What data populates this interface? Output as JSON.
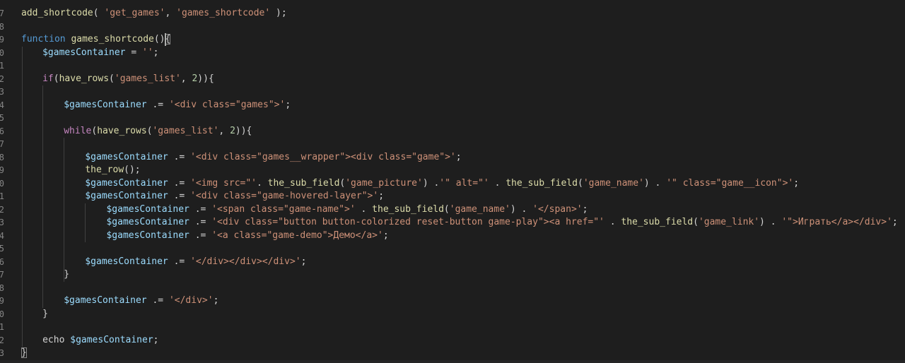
{
  "editor": {
    "line_numbers": [
      "7",
      "8",
      "9",
      "0",
      "1",
      "2",
      "3",
      "4",
      "5",
      "6",
      "7",
      "8",
      "9",
      "0",
      "1",
      "2",
      "3",
      "4",
      "5",
      "6",
      "7",
      "8",
      "9",
      "0",
      "1",
      "2",
      "3"
    ],
    "lines": [
      [
        [
          "fn",
          "add_shortcode"
        ],
        [
          "op",
          "( "
        ],
        [
          "str",
          "'get_games'"
        ],
        [
          "op",
          ", "
        ],
        [
          "str",
          "'games_shortcode'"
        ],
        [
          "op",
          " );"
        ]
      ],
      [],
      [
        [
          "kw",
          "function"
        ],
        [
          "op",
          " "
        ],
        [
          "fn",
          "games_shortcode"
        ],
        [
          "op",
          "()"
        ],
        [
          "op",
          "{"
        ]
      ],
      [
        [
          "var",
          "$gamesContainer"
        ],
        [
          "op",
          " = "
        ],
        [
          "str",
          "''"
        ],
        [
          "op",
          ";"
        ]
      ],
      [],
      [
        [
          "ctl",
          "if"
        ],
        [
          "op",
          "("
        ],
        [
          "fn",
          "have_rows"
        ],
        [
          "op",
          "("
        ],
        [
          "str",
          "'games_list'"
        ],
        [
          "op",
          ", "
        ],
        [
          "num",
          "2"
        ],
        [
          "op",
          "))"
        ],
        [
          "op",
          "{"
        ]
      ],
      [],
      [
        [
          "var",
          "$gamesContainer"
        ],
        [
          "op",
          " .= "
        ],
        [
          "str",
          "'<div class=\"games\">'"
        ],
        [
          "op",
          ";"
        ]
      ],
      [],
      [
        [
          "ctl",
          "while"
        ],
        [
          "op",
          "("
        ],
        [
          "fn",
          "have_rows"
        ],
        [
          "op",
          "("
        ],
        [
          "str",
          "'games_list'"
        ],
        [
          "op",
          ", "
        ],
        [
          "num",
          "2"
        ],
        [
          "op",
          "))"
        ],
        [
          "op",
          "{"
        ]
      ],
      [],
      [
        [
          "var",
          "$gamesContainer"
        ],
        [
          "op",
          " .= "
        ],
        [
          "str",
          "'<div class=\"games__wrapper\"><div class=\"game\">'"
        ],
        [
          "op",
          ";"
        ]
      ],
      [
        [
          "fn",
          "the_row"
        ],
        [
          "op",
          "();"
        ]
      ],
      [
        [
          "var",
          "$gamesContainer"
        ],
        [
          "op",
          " .= "
        ],
        [
          "str",
          "'<img src=\"'"
        ],
        [
          "op",
          ". "
        ],
        [
          "fn",
          "the_sub_field"
        ],
        [
          "op",
          "("
        ],
        [
          "str",
          "'game_picture'"
        ],
        [
          "op",
          ") ."
        ],
        [
          "str",
          "'\" alt=\"'"
        ],
        [
          "op",
          " . "
        ],
        [
          "fn",
          "the_sub_field"
        ],
        [
          "op",
          "("
        ],
        [
          "str",
          "'game_name'"
        ],
        [
          "op",
          ") . "
        ],
        [
          "str",
          "'\" class=\"game__icon\">'"
        ],
        [
          "op",
          ";"
        ]
      ],
      [
        [
          "var",
          "$gamesContainer"
        ],
        [
          "op",
          " .= "
        ],
        [
          "str",
          "'<div class=\"game-hovered-layer\">'"
        ],
        [
          "op",
          ";"
        ]
      ],
      [
        [
          "var",
          "$gamesContainer"
        ],
        [
          "op",
          " .= "
        ],
        [
          "str",
          "'<span class=\"game-name\">'"
        ],
        [
          "op",
          " . "
        ],
        [
          "fn",
          "the_sub_field"
        ],
        [
          "op",
          "("
        ],
        [
          "str",
          "'game_name'"
        ],
        [
          "op",
          ") . "
        ],
        [
          "str",
          "'</span>'"
        ],
        [
          "op",
          ";"
        ]
      ],
      [
        [
          "var",
          "$gamesContainer"
        ],
        [
          "op",
          " .= "
        ],
        [
          "str",
          "'<div class=\"button button-colorized reset-button game-play\"><a href=\"'"
        ],
        [
          "op",
          " . "
        ],
        [
          "fn",
          "the_sub_field"
        ],
        [
          "op",
          "("
        ],
        [
          "str",
          "'game_link'"
        ],
        [
          "op",
          ") . "
        ],
        [
          "str",
          "'\">Играть</a></div>'"
        ],
        [
          "op",
          ";"
        ]
      ],
      [
        [
          "var",
          "$gamesContainer"
        ],
        [
          "op",
          " .= "
        ],
        [
          "str",
          "'<a class=\"game-demo\">Демо</a>'"
        ],
        [
          "op",
          ";"
        ]
      ],
      [],
      [
        [
          "var",
          "$gamesContainer"
        ],
        [
          "op",
          " .= "
        ],
        [
          "str",
          "'</div></div></div>'"
        ],
        [
          "op",
          ";"
        ]
      ],
      [
        [
          "op",
          "}"
        ]
      ],
      [],
      [
        [
          "var",
          "$gamesContainer"
        ],
        [
          "op",
          " .= "
        ],
        [
          "str",
          "'</div>'"
        ],
        [
          "op",
          ";"
        ]
      ],
      [
        [
          "op",
          "}"
        ]
      ],
      [],
      [
        [
          "plain",
          "echo "
        ],
        [
          "var",
          "$gamesContainer"
        ],
        [
          "op",
          ";"
        ]
      ],
      [
        [
          "op",
          "}"
        ]
      ]
    ]
  }
}
